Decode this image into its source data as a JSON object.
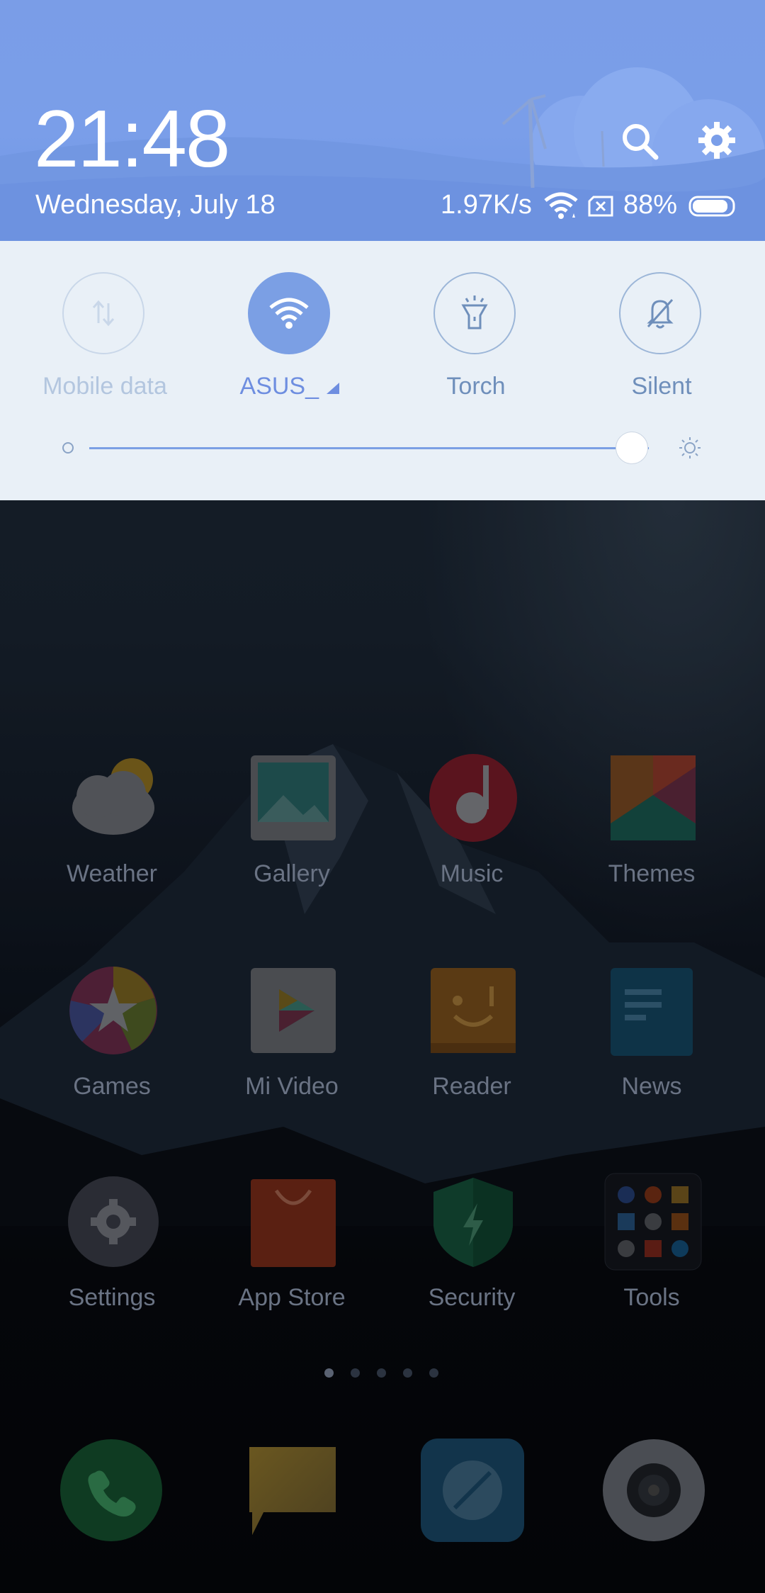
{
  "status_header": {
    "time": "21:48",
    "date": "Wednesday, July 18",
    "net_speed": "1.97K/s",
    "battery_percent": "88%",
    "battery_level": 0.88
  },
  "quick_toggles": [
    {
      "label": "Mobile data",
      "state": "off",
      "icon": "mobile-data-icon"
    },
    {
      "label": "ASUS_",
      "state": "on",
      "icon": "wifi-icon"
    },
    {
      "label": "Torch",
      "state": "available",
      "icon": "flashlight-icon"
    },
    {
      "label": "Silent",
      "state": "available",
      "icon": "bell-off-icon"
    }
  ],
  "brightness": {
    "level": 0.97
  },
  "apps": [
    {
      "name": "Weather",
      "icon": "weather-icon"
    },
    {
      "name": "Gallery",
      "icon": "gallery-icon"
    },
    {
      "name": "Music",
      "icon": "music-icon"
    },
    {
      "name": "Themes",
      "icon": "themes-icon"
    },
    {
      "name": "Games",
      "icon": "games-icon"
    },
    {
      "name": "Mi Video",
      "icon": "video-icon"
    },
    {
      "name": "Reader",
      "icon": "reader-icon"
    },
    {
      "name": "News",
      "icon": "news-icon"
    },
    {
      "name": "Settings",
      "icon": "settings-icon"
    },
    {
      "name": "App Store",
      "icon": "app-store-icon"
    },
    {
      "name": "Security",
      "icon": "security-icon"
    },
    {
      "name": "Tools",
      "icon": "tools-folder-icon"
    }
  ],
  "page_indicator": {
    "pages": 5,
    "current": 1
  },
  "dock": [
    {
      "icon": "phone-icon"
    },
    {
      "icon": "messages-icon"
    },
    {
      "icon": "browser-icon"
    },
    {
      "icon": "camera-icon"
    }
  ]
}
